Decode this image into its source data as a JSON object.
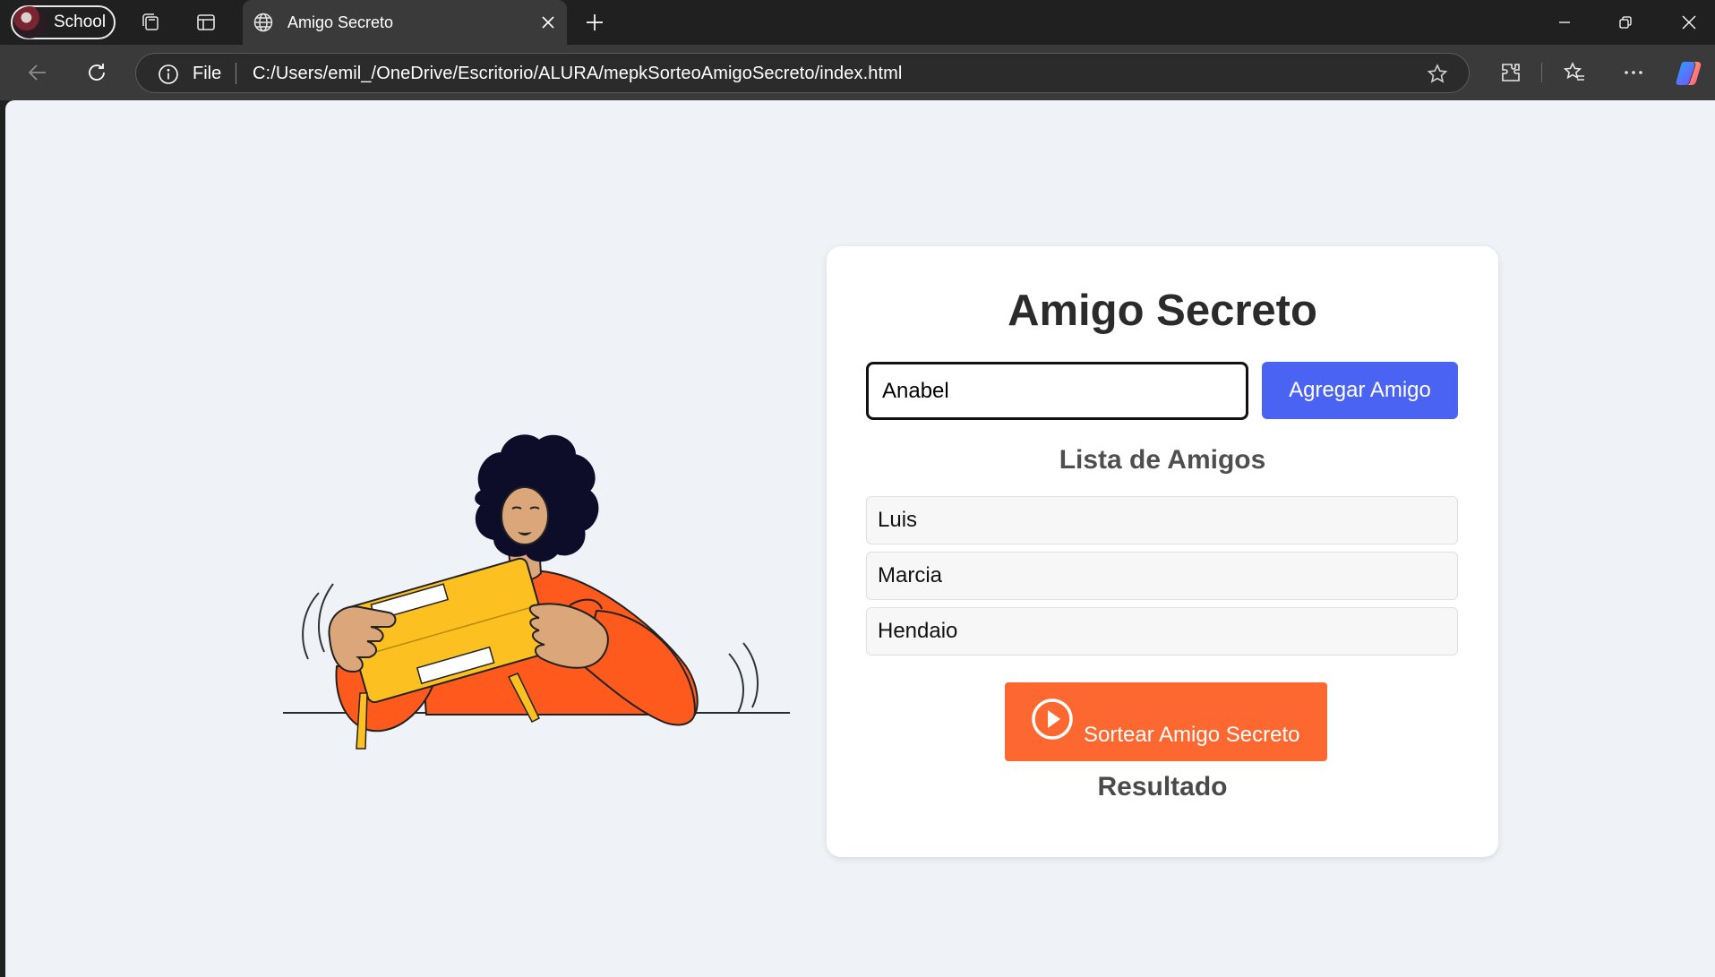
{
  "browser": {
    "profile_label": "School",
    "tab_title": "Amigo Secreto",
    "address_scheme": "File",
    "address_url": "C:/Users/emil_/OneDrive/Escritorio/ALURA/mepkSorteoAmigoSecreto/index.html"
  },
  "app": {
    "title": "Amigo Secreto",
    "input_value": "Anabel",
    "add_button_label": "Agregar Amigo",
    "list_heading": "Lista de Amigos",
    "friends": [
      "Luis",
      "Marcia",
      "Hendaio"
    ],
    "draw_button_label": "Sortear Amigo Secreto",
    "result_heading": "Resultado"
  },
  "colors": {
    "page_background": "#eff2f6",
    "primary_button": "#4b63f2",
    "draw_button": "#fd6730"
  }
}
